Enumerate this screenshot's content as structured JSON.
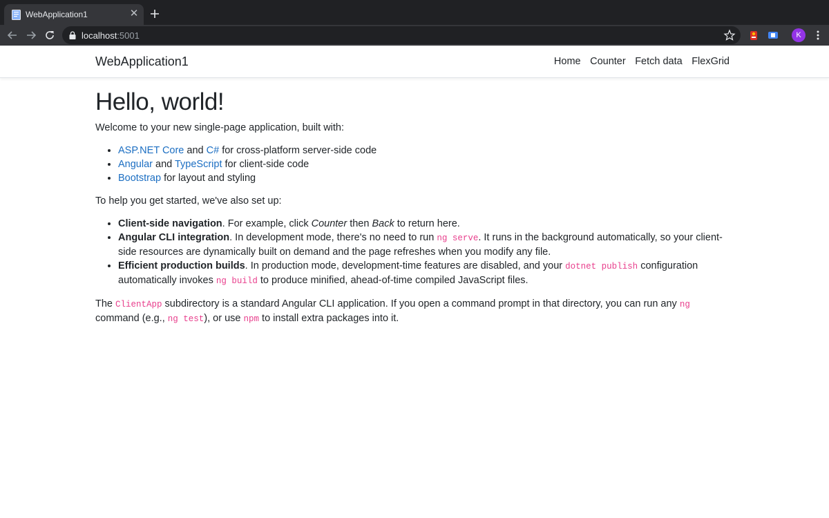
{
  "browser": {
    "tab_title": "WebApplication1",
    "url_host": "localhost",
    "url_port": ":5001",
    "avatar_letter": "K"
  },
  "navbar": {
    "brand": "WebApplication1",
    "links": [
      "Home",
      "Counter",
      "Fetch data",
      "FlexGrid"
    ]
  },
  "content": {
    "heading": "Hello, world!",
    "intro": "Welcome to your new single-page application, built with:",
    "built_with": [
      {
        "parts": [
          {
            "link": "ASP.NET Core"
          },
          {
            "text": " and "
          },
          {
            "link": "C#"
          },
          {
            "text": " for cross-platform server-side code"
          }
        ]
      },
      {
        "parts": [
          {
            "link": "Angular"
          },
          {
            "text": " and "
          },
          {
            "link": "TypeScript"
          },
          {
            "text": " for client-side code"
          }
        ]
      },
      {
        "parts": [
          {
            "link": "Bootstrap"
          },
          {
            "text": " for layout and styling"
          }
        ]
      }
    ],
    "setup_intro": "To help you get started, we've also set up:",
    "features": [
      {
        "parts": [
          {
            "bold": "Client-side navigation"
          },
          {
            "text": ". For example, click "
          },
          {
            "italic": "Counter"
          },
          {
            "text": " then "
          },
          {
            "italic": "Back"
          },
          {
            "text": " to return here."
          }
        ]
      },
      {
        "parts": [
          {
            "bold": "Angular CLI integration"
          },
          {
            "text": ". In development mode, there's no need to run "
          },
          {
            "code": "ng serve"
          },
          {
            "text": ". It runs in the background automatically, so your client-side resources are dynamically built on demand and the page refreshes when you modify any file."
          }
        ]
      },
      {
        "parts": [
          {
            "bold": "Efficient production builds"
          },
          {
            "text": ". In production mode, development-time features are disabled, and your "
          },
          {
            "code": "dotnet publish"
          },
          {
            "text": " configuration automatically invokes "
          },
          {
            "code": "ng build"
          },
          {
            "text": " to produce minified, ahead-of-time compiled JavaScript files."
          }
        ]
      }
    ],
    "closing": [
      {
        "text": "The "
      },
      {
        "code": "ClientApp"
      },
      {
        "text": " subdirectory is a standard Angular CLI application. If you open a command prompt in that directory, you can run any "
      },
      {
        "code": "ng"
      },
      {
        "text": " command (e.g., "
      },
      {
        "code": "ng test"
      },
      {
        "text": "), or use "
      },
      {
        "code": "npm"
      },
      {
        "text": " to install extra packages into it."
      }
    ]
  }
}
